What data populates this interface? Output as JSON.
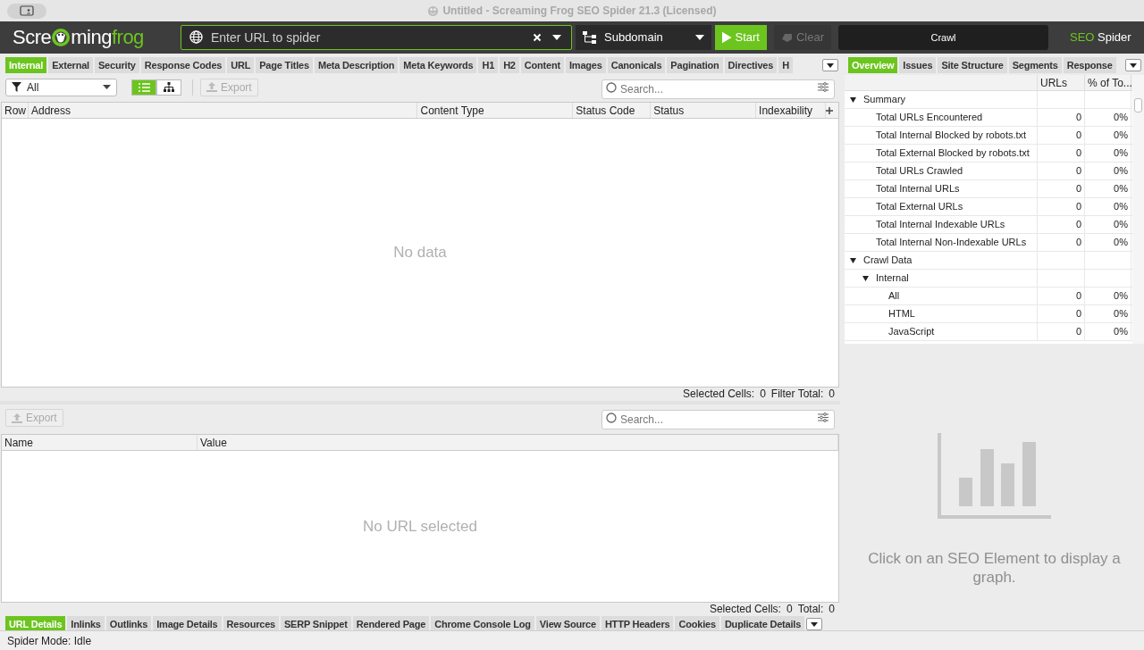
{
  "window": {
    "title": "Untitled - Screaming Frog SEO Spider 21.3 (Licensed)"
  },
  "toolbar": {
    "logo": [
      {
        "text": "Scre",
        "accent": false
      },
      {
        "text": "ming",
        "accent": false
      },
      {
        "text": "frog",
        "accent": true
      }
    ],
    "url_field": {
      "placeholder": "Enter URL to spider"
    },
    "mode_dropdown": {
      "value": "Subdomain"
    },
    "start_button": {
      "label": "Start"
    },
    "clear_button": {
      "label": "Clear",
      "disabled": true
    },
    "progress": {
      "label": "Crawl",
      "level": 0
    },
    "brand": {
      "accent": "SEO",
      "rest": "Spider"
    }
  },
  "main_tabs": [
    {
      "label": "Internal",
      "selected": true
    },
    {
      "label": "External",
      "selected": false
    },
    {
      "label": "Security",
      "selected": false
    },
    {
      "label": "Response Codes",
      "selected": false
    },
    {
      "label": "URL",
      "selected": false
    },
    {
      "label": "Page Titles",
      "selected": false
    },
    {
      "label": "Meta Description",
      "selected": false
    },
    {
      "label": "Meta Keywords",
      "selected": false
    },
    {
      "label": "H1",
      "selected": false
    },
    {
      "label": "H2",
      "selected": false
    },
    {
      "label": "Content",
      "selected": false
    },
    {
      "label": "Images",
      "selected": false
    },
    {
      "label": "Canonicals",
      "selected": false
    },
    {
      "label": "Pagination",
      "selected": false
    },
    {
      "label": "Directives",
      "selected": false
    },
    {
      "label": "H",
      "selected": false
    }
  ],
  "filter": {
    "value": "All",
    "list_view": true,
    "export_label": "Export",
    "search_placeholder": "Search..."
  },
  "table": {
    "columns": [
      {
        "label": "Row"
      },
      {
        "label": "Address"
      },
      {
        "label": "Content Type"
      },
      {
        "label": "Status Code"
      },
      {
        "label": "Status"
      },
      {
        "label": "Indexability"
      }
    ],
    "empty": "No data",
    "footer": [
      {
        "label": "Selected Cells:",
        "value": "0"
      },
      {
        "label": "Filter Total:",
        "value": "0"
      }
    ]
  },
  "details": {
    "export_label": "Export",
    "search_placeholder": "Search...",
    "columns": [
      {
        "label": "Name"
      },
      {
        "label": "Value"
      }
    ],
    "empty": "No URL selected",
    "footer": [
      {
        "label": "Selected Cells:",
        "value": "0"
      },
      {
        "label": "Total:",
        "value": "0"
      }
    ]
  },
  "detail_tabs": [
    {
      "label": "URL Details",
      "selected": true
    },
    {
      "label": "Inlinks",
      "selected": false
    },
    {
      "label": "Outlinks",
      "selected": false
    },
    {
      "label": "Image Details",
      "selected": false
    },
    {
      "label": "Resources",
      "selected": false
    },
    {
      "label": "SERP Snippet",
      "selected": false
    },
    {
      "label": "Rendered Page",
      "selected": false
    },
    {
      "label": "Chrome Console Log",
      "selected": false
    },
    {
      "label": "View Source",
      "selected": false
    },
    {
      "label": "HTTP Headers",
      "selected": false
    },
    {
      "label": "Cookies",
      "selected": false
    },
    {
      "label": "Duplicate Details",
      "selected": false
    }
  ],
  "side_tabs": [
    {
      "label": "Overview",
      "selected": true
    },
    {
      "label": "Issues",
      "selected": false
    },
    {
      "label": "Site Structure",
      "selected": false
    },
    {
      "label": "Segments",
      "selected": false
    },
    {
      "label": "Response",
      "selected": false
    }
  ],
  "overview": {
    "columns": [
      "URLs",
      "% of To..."
    ],
    "tree": [
      {
        "label": "Summary",
        "expanded": true,
        "children": [
          {
            "label": "Total URLs Encountered",
            "urls": "0",
            "percent": "0%"
          },
          {
            "label": "Total Internal Blocked by robots.txt",
            "urls": "0",
            "percent": "0%"
          },
          {
            "label": "Total External Blocked by robots.txt",
            "urls": "0",
            "percent": "0%"
          },
          {
            "label": "Total URLs Crawled",
            "urls": "0",
            "percent": "0%"
          },
          {
            "label": "Total Internal URLs",
            "urls": "0",
            "percent": "0%"
          },
          {
            "label": "Total External URLs",
            "urls": "0",
            "percent": "0%"
          },
          {
            "label": "Total Internal Indexable URLs",
            "urls": "0",
            "percent": "0%"
          },
          {
            "label": "Total Internal Non-Indexable URLs",
            "urls": "0",
            "percent": "0%"
          }
        ]
      },
      {
        "label": "Crawl Data",
        "expanded": true,
        "children": [
          {
            "label": "Internal",
            "expanded": true,
            "children": [
              {
                "label": "All",
                "urls": "0",
                "percent": "0%"
              },
              {
                "label": "HTML",
                "urls": "0",
                "percent": "0%"
              },
              {
                "label": "JavaScript",
                "urls": "0",
                "percent": "0%"
              }
            ]
          }
        ]
      }
    ]
  },
  "graph": {
    "message": "Click on an SEO Element to display a graph."
  },
  "status_bar": {
    "text": "Spider Mode: Idle"
  }
}
